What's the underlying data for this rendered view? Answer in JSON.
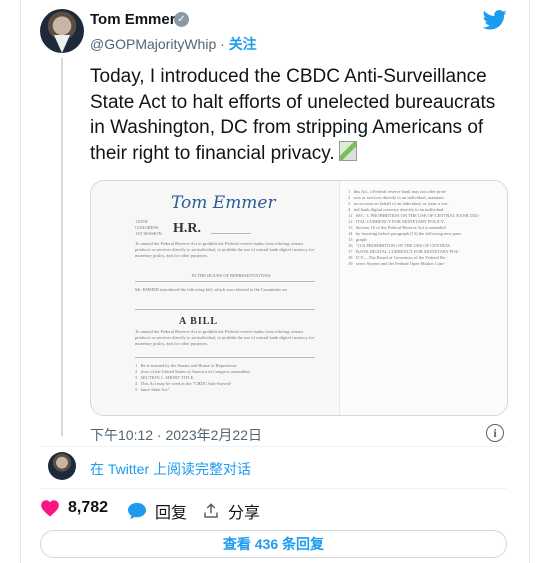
{
  "author": {
    "name": "Tom Emmer",
    "handle": "@GOPMajorityWhip",
    "separator": "·",
    "follow_label": "关注"
  },
  "tweet": {
    "text": "Today, I introduced the CBDC Anti-Surveillance State Act to halt efforts of unelected bureaucrats in Washington, DC from stripping Americans of their right to financial privacy.",
    "timestamp": "下午10:12 · 2023年2月22日"
  },
  "media": {
    "document_title": "H.R.",
    "bill_heading": "A BILL",
    "house_heading": "IN THE HOUSE OF REPRESENTATIVES"
  },
  "read_on_twitter": "在 Twitter 上阅读完整对话",
  "actions": {
    "like_count": "8,782",
    "reply_label": "回复",
    "share_label": "分享"
  },
  "view_replies": "查看 436 条回复",
  "colors": {
    "accent": "#1d9bf0",
    "like": "#f91880",
    "text": "#0f1419",
    "secondary": "#536471"
  },
  "icons": [
    "verified-badge-icon",
    "twitter-bird-icon",
    "info-icon",
    "heart-icon",
    "reply-bubble-icon",
    "share-icon"
  ]
}
